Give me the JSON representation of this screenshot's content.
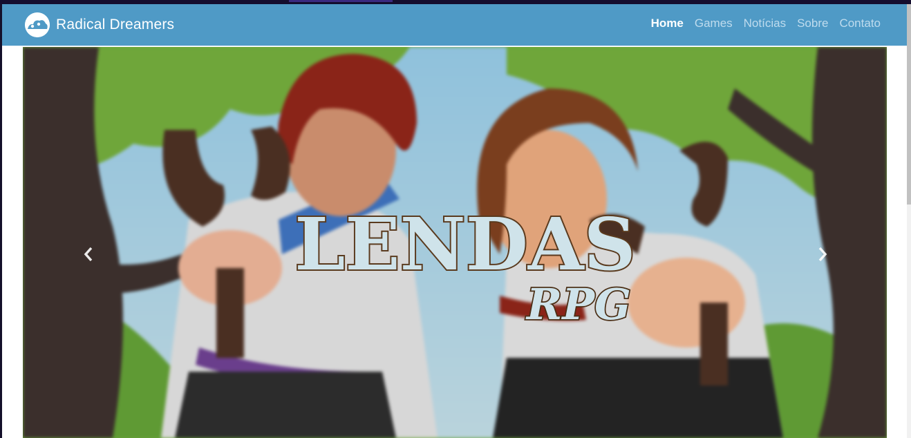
{
  "navbar": {
    "brand": "Radical Dreamers",
    "brand_icon": "cloud-logo-icon",
    "links": [
      {
        "label": "Home",
        "active": true
      },
      {
        "label": "Games",
        "active": false
      },
      {
        "label": "Notícias",
        "active": false
      },
      {
        "label": "Sobre",
        "active": false
      },
      {
        "label": "Contato",
        "active": false
      }
    ]
  },
  "carousel": {
    "title_main": "LENDAS",
    "title_sub": "RPG",
    "prev_icon": "chevron-left-icon",
    "next_icon": "chevron-right-icon"
  },
  "colors": {
    "navbar": "#4f9ac6",
    "title_fill": "#cfe3ea",
    "title_stroke": "#5a3a1e"
  }
}
